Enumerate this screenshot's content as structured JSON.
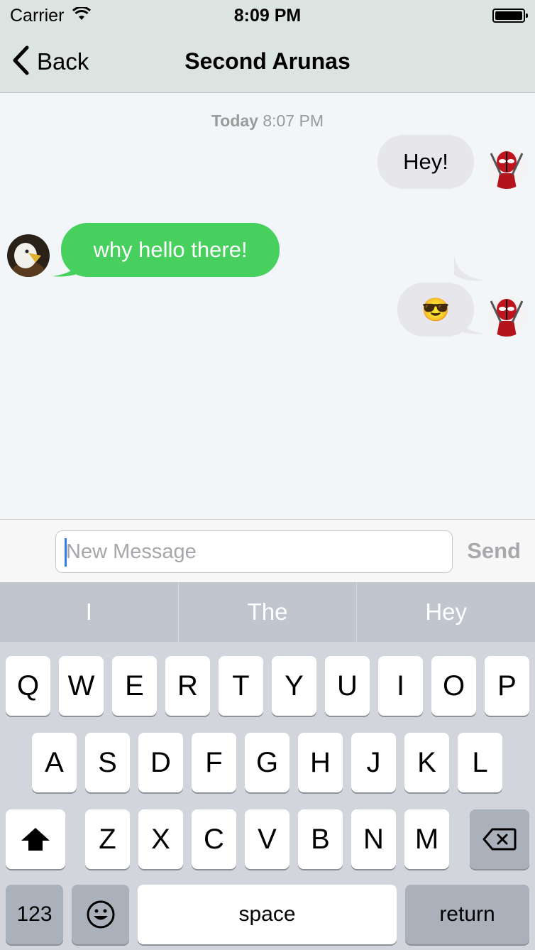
{
  "status_bar": {
    "carrier": "Carrier",
    "time": "8:09 PM"
  },
  "nav": {
    "back_label": "Back",
    "title": "Second Arunas"
  },
  "chat": {
    "timestamp_day": "Today",
    "timestamp_time": "8:07 PM",
    "messages": [
      {
        "direction": "outgoing",
        "text": "Hey!"
      },
      {
        "direction": "incoming",
        "text": "why hello there!"
      },
      {
        "direction": "outgoing",
        "text": "😎"
      }
    ]
  },
  "composer": {
    "placeholder": "New Message",
    "value": "",
    "send_label": "Send"
  },
  "predictions": [
    "I",
    "The",
    "Hey"
  ],
  "keyboard": {
    "row1": [
      "Q",
      "W",
      "E",
      "R",
      "T",
      "Y",
      "U",
      "I",
      "O",
      "P"
    ],
    "row2": [
      "A",
      "S",
      "D",
      "F",
      "G",
      "H",
      "J",
      "K",
      "L"
    ],
    "row3": [
      "Z",
      "X",
      "C",
      "V",
      "B",
      "N",
      "M"
    ],
    "numbers_label": "123",
    "space_label": "space",
    "return_label": "return"
  },
  "colors": {
    "incoming_bubble": "#47d05d",
    "outgoing_bubble": "#e6e6eb",
    "nav_bg": "#dce4e2"
  }
}
